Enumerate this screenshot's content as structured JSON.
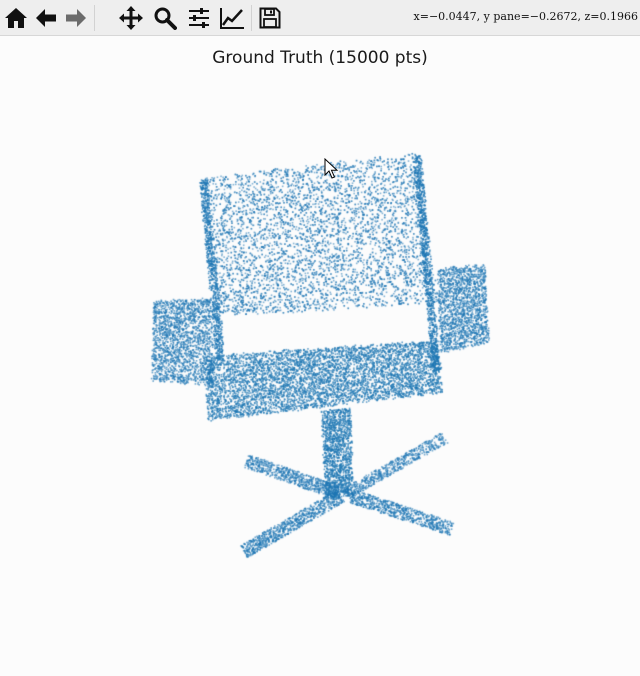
{
  "toolbar": {
    "tools": [
      {
        "name": "home-button",
        "icon": "home-icon"
      },
      {
        "name": "back-button",
        "icon": "arrow-left-icon"
      },
      {
        "name": "forward-button",
        "icon": "arrow-right-icon"
      },
      {
        "name": "pan-button",
        "icon": "move-icon"
      },
      {
        "name": "zoom-button",
        "icon": "magnifier-icon"
      },
      {
        "name": "configure-subplots-button",
        "icon": "sliders-icon"
      },
      {
        "name": "edit-axis-button",
        "icon": "line-chart-icon"
      },
      {
        "name": "save-button",
        "icon": "floppy-disk-icon"
      }
    ],
    "coords": "x=−0.0447, y pane=−0.2672, z=0.1966"
  },
  "plot": {
    "title": "Ground Truth (15000 pts)",
    "point_color": "#1f77b4",
    "background": "#fcfcfc"
  }
}
